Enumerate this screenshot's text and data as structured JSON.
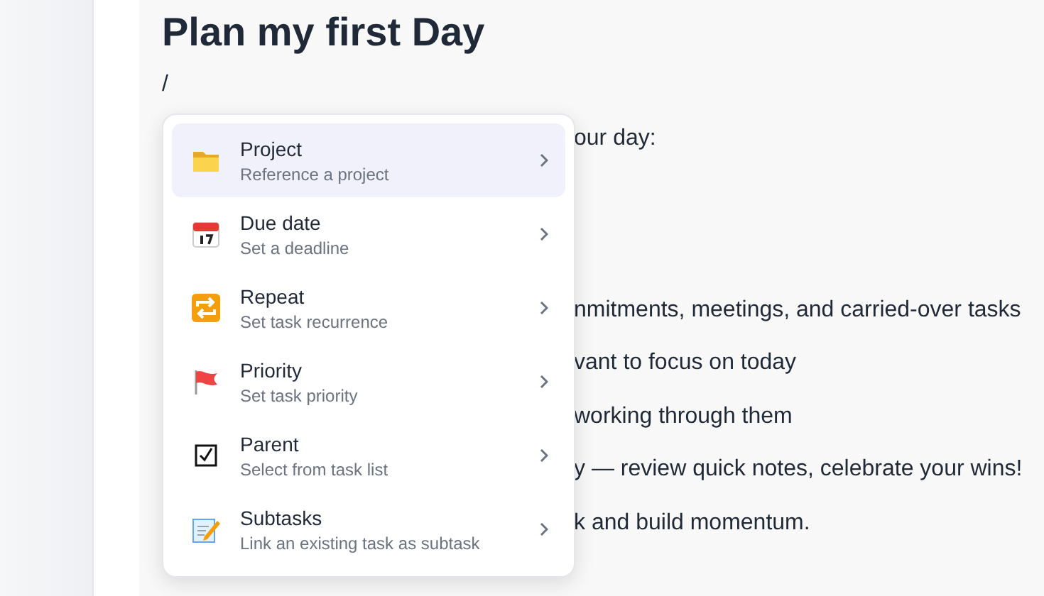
{
  "document": {
    "title": "Plan my first Day",
    "command": "/",
    "body_lines": [
      "our day:",
      "nmitments, meetings, and carried-over tasks",
      "vant to focus on today",
      "working through them",
      "y — review quick notes, celebrate your wins!",
      "k and build momentum."
    ]
  },
  "slash_menu": {
    "items": [
      {
        "title": "Project",
        "subtitle": "Reference a project",
        "selected": true
      },
      {
        "title": "Due date",
        "subtitle": "Set a deadline",
        "selected": false
      },
      {
        "title": "Repeat",
        "subtitle": "Set task recurrence",
        "selected": false
      },
      {
        "title": "Priority",
        "subtitle": "Set task priority",
        "selected": false
      },
      {
        "title": "Parent",
        "subtitle": "Select from task list",
        "selected": false
      },
      {
        "title": "Subtasks",
        "subtitle": "Link an existing task as subtask",
        "selected": false
      }
    ]
  }
}
